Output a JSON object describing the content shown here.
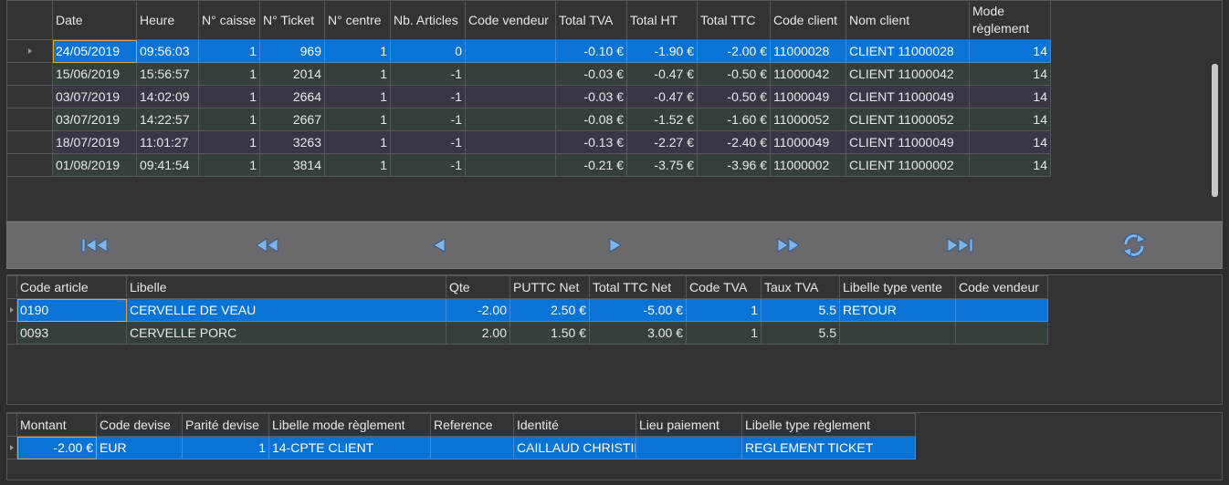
{
  "tickets": {
    "columns": [
      "Date",
      "Heure",
      "N° caisse",
      "N° Ticket",
      "N° centre",
      "Nb. Articles",
      "Code vendeur",
      "Total TVA",
      "Total HT",
      "Total TTC",
      "Code client",
      "Nom client",
      "Mode règlement"
    ],
    "rows": [
      [
        "24/05/2019",
        "09:56:03",
        "1",
        "969",
        "1",
        "0",
        "",
        "-0.10 €",
        "-1.90 €",
        "-2.00 €",
        "11000028",
        "CLIENT  11000028",
        "14"
      ],
      [
        "15/06/2019",
        "15:56:57",
        "1",
        "2014",
        "1",
        "-1",
        "",
        "-0.03 €",
        "-0.47 €",
        "-0.50 €",
        "11000042",
        "CLIENT  11000042",
        "14"
      ],
      [
        "03/07/2019",
        "14:02:09",
        "1",
        "2664",
        "1",
        "-1",
        "",
        "-0.03 €",
        "-0.47 €",
        "-0.50 €",
        "11000049",
        "CLIENT  11000049",
        "14"
      ],
      [
        "03/07/2019",
        "14:22:57",
        "1",
        "2667",
        "1",
        "-1",
        "",
        "-0.08 €",
        "-1.52 €",
        "-1.60 €",
        "11000052",
        "CLIENT  11000052",
        "14"
      ],
      [
        "18/07/2019",
        "11:01:27",
        "1",
        "3263",
        "1",
        "-1",
        "",
        "-0.13 €",
        "-2.27 €",
        "-2.40 €",
        "11000049",
        "CLIENT  11000049",
        "14"
      ],
      [
        "01/08/2019",
        "09:41:54",
        "1",
        "3814",
        "1",
        "-1",
        "",
        "-0.21 €",
        "-3.75 €",
        "-3.96 €",
        "11000002",
        "CLIENT  11000002",
        "14"
      ]
    ]
  },
  "navigation": {
    "buttons": [
      "first-record",
      "previous-page",
      "previous-record",
      "next-record",
      "next-page",
      "last-record",
      "refresh"
    ]
  },
  "articles": {
    "columns": [
      "Code article",
      "Libelle",
      "Qte",
      "PUTTC Net",
      "Total TTC Net",
      "Code TVA",
      "Taux TVA",
      "Libelle type vente",
      "Code vendeur"
    ],
    "rows": [
      [
        "0190",
        "CERVELLE DE VEAU",
        "-2.00",
        "2.50 €",
        "-5.00 €",
        "1",
        "5.5",
        "RETOUR",
        ""
      ],
      [
        "0093",
        "CERVELLE PORC",
        "2.00",
        "1.50 €",
        "3.00 €",
        "1",
        "5.5",
        "",
        ""
      ]
    ]
  },
  "payments": {
    "columns": [
      "Montant",
      "Code devise",
      "Parité devise",
      "Libelle mode règlement",
      "Reference",
      "Identité",
      "Lieu paiement",
      "Libelle type règlement"
    ],
    "rows": [
      [
        "-2.00 €",
        "EUR",
        "1",
        "14-CPTE CLIENT",
        "",
        "CAILLAUD CHRISTINE",
        "",
        "REGLEMENT TICKET"
      ]
    ]
  },
  "colors": {
    "selected_row": "#0a74d6",
    "row_green": "#34413a",
    "row_purple": "#3a3645",
    "nav_bar": "#6a6a6e",
    "nav_icon": "#7fb4e8"
  }
}
